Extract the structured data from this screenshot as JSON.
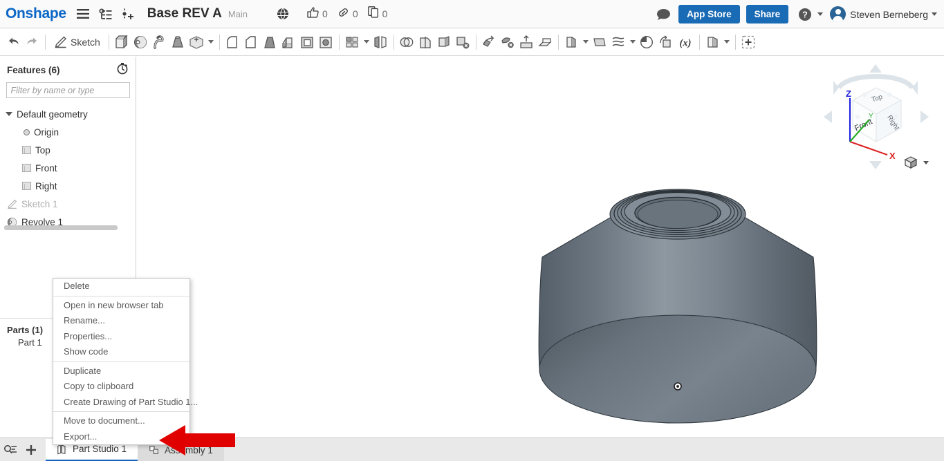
{
  "header": {
    "logo": "Onshape",
    "menu_icon": "hamburger-menu-icon",
    "versions_icon": "version-graph-icon",
    "add_version_icon": "add-version-icon",
    "document_title": "Base REV A",
    "workspace": "Main",
    "globe_icon": "globe-icon",
    "counters": [
      {
        "icon": "thumbs-up-icon",
        "name": "likes",
        "value": "0"
      },
      {
        "icon": "link-icon",
        "name": "links",
        "value": "0"
      },
      {
        "icon": "copy-icon",
        "name": "copies",
        "value": "0"
      }
    ],
    "comment_icon": "comment-icon",
    "app_store_label": "App Store",
    "share_label": "Share",
    "help_icon": "help-icon",
    "user_name": "Steven Berneberg",
    "accent_blue": "#1a6bb5",
    "logo_blue": "#0a67c7"
  },
  "toolbar": {
    "undo": "undo-icon",
    "redo": "redo-icon",
    "sketch_label": "Sketch",
    "tools": [
      "extrude-icon",
      "revolve-icon",
      "sweep-icon",
      "loft-icon",
      "thicken-icon",
      "fillet-icon",
      "chamfer-icon",
      "draft-icon",
      "rib-icon",
      "shell-icon",
      "hole-icon",
      "pattern-icon",
      "mirror-icon",
      "boolean-icon",
      "split-icon",
      "transform-tool-icon",
      "delete-face-icon",
      "move-face-icon",
      "replace-face-icon",
      "enclose-icon",
      "surface-fill-icon",
      "delete-part-icon",
      "import-derived-icon",
      "export-icon",
      "sheet-metal-icon",
      "plane-icon",
      "curve-icon",
      "section-view-icon",
      "transform-icon",
      "variable-icon",
      "assembly-icon",
      "add-custom-feature-icon"
    ]
  },
  "features_panel": {
    "title": "Features (6)",
    "history_icon": "history-timer-icon",
    "filter_placeholder": "Filter by name or type",
    "tree": [
      {
        "label": "Default geometry",
        "icon": "chevron-down-icon",
        "dim": false,
        "indent": 0
      },
      {
        "label": "Origin",
        "icon": "origin-icon",
        "dim": false,
        "indent": 1
      },
      {
        "label": "Top",
        "icon": "plane-icon",
        "dim": false,
        "indent": 1
      },
      {
        "label": "Front",
        "icon": "plane-icon",
        "dim": false,
        "indent": 1
      },
      {
        "label": "Right",
        "icon": "plane-icon",
        "dim": false,
        "indent": 1
      },
      {
        "label": "Sketch 1",
        "icon": "sketch-icon",
        "dim": true,
        "indent": 0
      },
      {
        "label": "Revolve 1",
        "icon": "revolve-icon",
        "dim": false,
        "indent": 0
      }
    ],
    "parts_title": "Parts (1)",
    "parts": [
      {
        "label": "Part 1"
      }
    ]
  },
  "context_menu": {
    "groups": [
      [
        "Delete"
      ],
      [
        "Open in new browser tab",
        "Rename...",
        "Properties...",
        "Show code"
      ],
      [
        "Duplicate",
        "Copy to clipboard",
        "Create Drawing of Part Studio 1..."
      ],
      [
        "Move to document...",
        "Export..."
      ]
    ]
  },
  "viewport": {
    "model_name": "revolved-cone-part",
    "model_color": "#6e7a85",
    "model_color_light": "#8d98a2",
    "model_color_dark": "#4e5861",
    "origin_marker": "origin-point-marker",
    "view_cube": {
      "faces": {
        "top": "Top",
        "front": "Front",
        "right": "Right"
      },
      "axes": [
        {
          "label": "Z",
          "color": "#2222dd"
        },
        {
          "label": "Y",
          "color": "#22aa22"
        },
        {
          "label": "X",
          "color": "#dd2222"
        }
      ],
      "name": "view-orientation-cube"
    },
    "display_mode_icon": "display-mode-cube-icon"
  },
  "tabbar": {
    "filter_icon": "tab-filter-icon",
    "add_icon": "add-tab-icon",
    "tabs": [
      {
        "label": "Part Studio 1",
        "icon": "part-studio-icon",
        "active": true
      },
      {
        "label": "Assembly 1",
        "icon": "assembly-icon",
        "active": false
      }
    ]
  },
  "annotation": {
    "arrow": "red-pointer-arrow",
    "color": "#e00000"
  }
}
